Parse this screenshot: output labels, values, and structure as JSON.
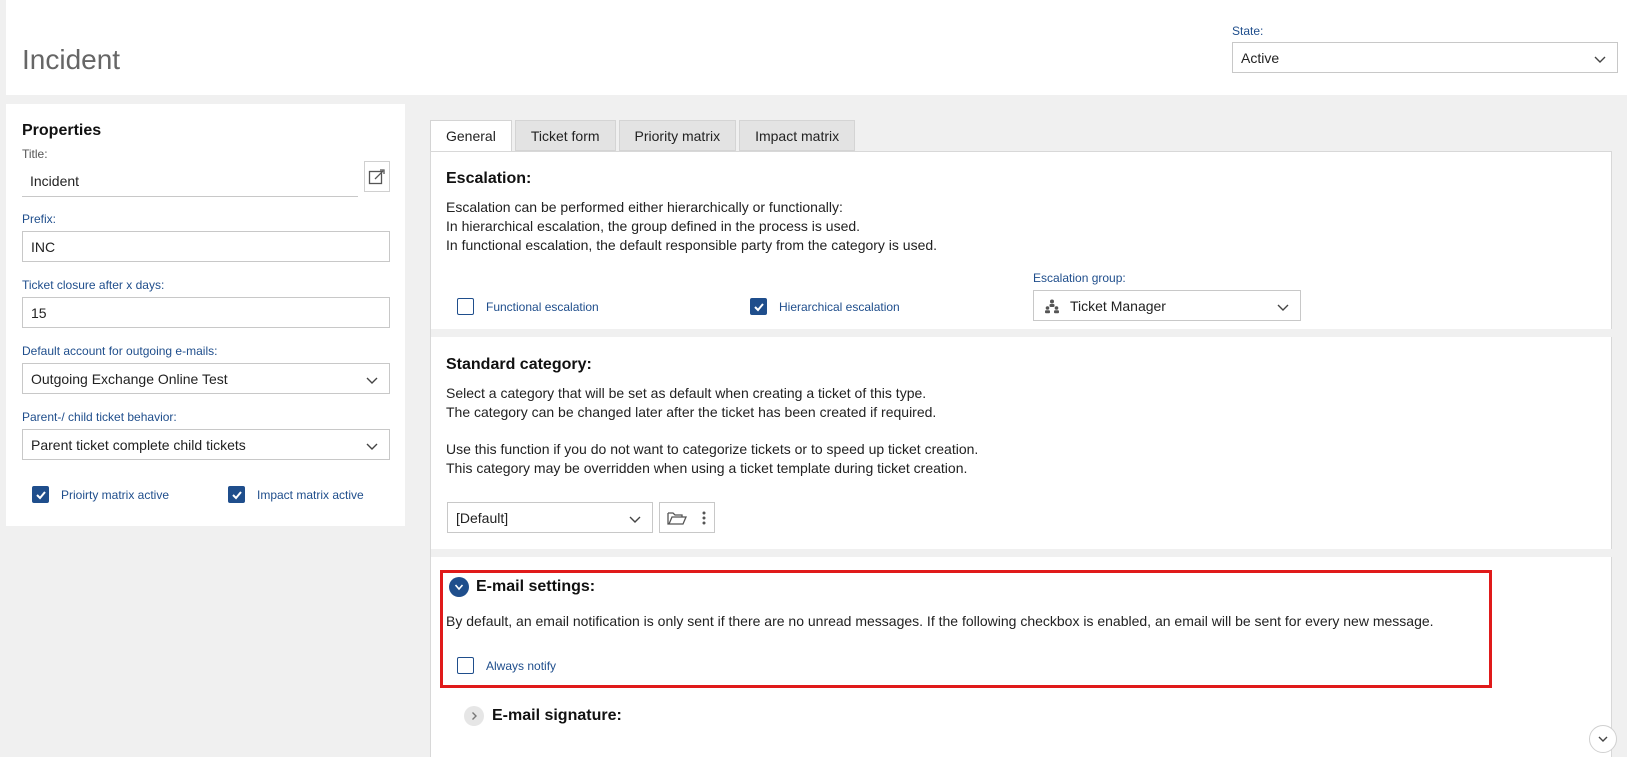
{
  "header": {
    "title": "Incident",
    "state_label": "State:",
    "state_value": "Active"
  },
  "properties": {
    "heading": "Properties",
    "title_label": "Title:",
    "title_value": "Incident",
    "prefix_label": "Prefix:",
    "prefix_value": "INC",
    "closure_label": "Ticket closure after x days:",
    "closure_value": "15",
    "account_label": "Default account for outgoing e-mails:",
    "account_value": "Outgoing Exchange Online Test",
    "behavior_label": "Parent-/ child ticket behavior:",
    "behavior_value": "Parent ticket complete child tickets",
    "priority_matrix_label": "Prioirty matrix active",
    "priority_matrix_checked": true,
    "impact_matrix_label": "Impact matrix active",
    "impact_matrix_checked": true
  },
  "tabs": [
    {
      "label": "General",
      "active": true
    },
    {
      "label": "Ticket form",
      "active": false
    },
    {
      "label": "Priority matrix",
      "active": false
    },
    {
      "label": "Impact matrix",
      "active": false
    }
  ],
  "escalation": {
    "title": "Escalation:",
    "line1": "Escalation can be performed either hierarchically or functionally:",
    "line2": "In hierarchical escalation, the group defined in the process is used.",
    "line3": "In functional escalation, the default responsible party from the category is used.",
    "functional_label": "Functional escalation",
    "functional_checked": false,
    "hierarchical_label": "Hierarchical escalation",
    "hierarchical_checked": true,
    "group_label": "Escalation group:",
    "group_value": "Ticket Manager"
  },
  "category": {
    "title": "Standard category:",
    "line1": "Select a category that will be set as default when creating a ticket of this type.",
    "line2": "The category can be changed later after the ticket has been created if required.",
    "line3": "Use this function if you do not want to categorize tickets or to speed up ticket creation.",
    "line4": "This category may be overridden when using a ticket template during ticket creation.",
    "value": "[Default]"
  },
  "email": {
    "title": "E-mail settings:",
    "text": "By default, an email notification is only sent if there are no unread messages. If the following checkbox is enabled, an email will be sent for every new message.",
    "always_notify_label": "Always notify",
    "always_notify_checked": false,
    "signature_title": "E-mail signature:"
  },
  "colors": {
    "accent": "#1f4e8c",
    "highlight": "#e01a1a"
  }
}
